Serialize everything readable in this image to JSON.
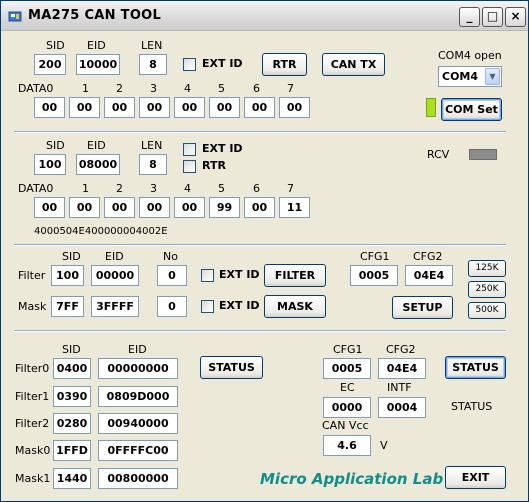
{
  "window": {
    "title": "MA275 CAN TOOL",
    "buttons": {
      "minimize": "_",
      "maximize": "□",
      "close": "×"
    }
  },
  "tx": {
    "sid_label": "SID",
    "eid_label": "EID",
    "len_label": "LEN",
    "sid": "200",
    "eid": "10000",
    "len": "8",
    "extid_label": "EXT ID",
    "rtr_button": "RTR",
    "cantx_button": "CAN TX",
    "data_labels": [
      "DATA0",
      "1",
      "2",
      "3",
      "4",
      "5",
      "6",
      "7"
    ],
    "data": [
      "00",
      "00",
      "00",
      "00",
      "00",
      "00",
      "00",
      "00"
    ]
  },
  "com": {
    "label": "COM4 open",
    "selected": "COM4",
    "set_button": "COM Set",
    "led_color": "#a8e020"
  },
  "rx": {
    "sid_label": "SID",
    "eid_label": "EID",
    "len_label": "LEN",
    "sid": "100",
    "eid": "08000",
    "len": "8",
    "extid_label": "EXT ID",
    "rtr_label": "RTR",
    "rcv_label": "RCV",
    "data_labels": [
      "DATA0",
      "1",
      "2",
      "3",
      "4",
      "5",
      "6",
      "7"
    ],
    "data": [
      "00",
      "00",
      "00",
      "00",
      "00",
      "99",
      "00",
      "11"
    ],
    "raw": "4000504E400000004002E"
  },
  "filter": {
    "sid_label": "SID",
    "eid_label": "EID",
    "no_label": "No",
    "filter_label": "Filter",
    "mask_label": "Mask",
    "filter_sid": "100",
    "filter_eid": "00000",
    "filter_no": "0",
    "mask_sid": "7FF",
    "mask_eid": "3FFFF",
    "mask_no": "0",
    "extid_label": "EXT ID",
    "filter_button": "FILTER",
    "mask_button": "MASK",
    "cfg1_label": "CFG1",
    "cfg2_label": "CFG2",
    "cfg1": "0005",
    "cfg2": "04E4",
    "setup_button": "SETUP",
    "speeds": [
      "125K",
      "250K",
      "500K"
    ]
  },
  "status": {
    "sid_label": "SID",
    "eid_label": "EID",
    "rows": [
      {
        "label": "Filter0",
        "sid": "0400",
        "eid": "00000000"
      },
      {
        "label": "Filter1",
        "sid": "0390",
        "eid": "0809D000"
      },
      {
        "label": "Filter2",
        "sid": "0280",
        "eid": "00940000"
      },
      {
        "label": "Mask0",
        "sid": "1FFD",
        "eid": "0FFFFC00"
      },
      {
        "label": "Mask1",
        "sid": "1440",
        "eid": "00800000"
      }
    ],
    "status_button": "STATUS",
    "cfg1_label": "CFG1",
    "cfg2_label": "CFG2",
    "cfg1": "0005",
    "cfg2": "04E4",
    "status_button2": "STATUS",
    "ec_label": "EC",
    "intf_label": "INTF",
    "ec": "0000",
    "intf": "0004",
    "status_text": "STATUS",
    "vcc_label": "CAN Vcc",
    "vcc": "4.6",
    "vcc_unit": "V"
  },
  "footer": {
    "brand": "Micro Application Lab",
    "exit_button": "EXIT"
  }
}
